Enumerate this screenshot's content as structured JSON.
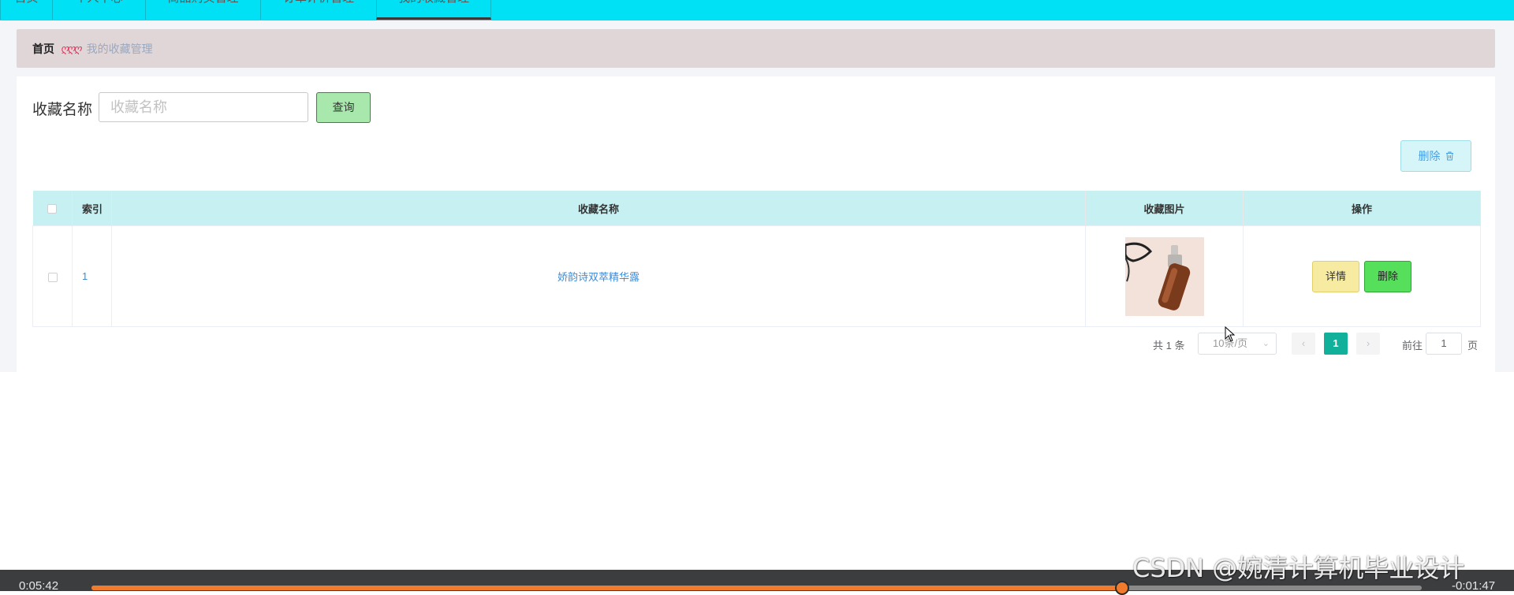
{
  "nav": {
    "tabs": [
      {
        "label": "首页",
        "active": false
      },
      {
        "label": "个人中心",
        "active": false
      },
      {
        "label": "商品购买管理",
        "active": false
      },
      {
        "label": "订单评价管理",
        "active": false
      },
      {
        "label": "我的收藏管理",
        "active": true
      }
    ]
  },
  "breadcrumb": {
    "home": "首页",
    "separator": "ღღღ",
    "current": "我的收藏管理"
  },
  "search": {
    "label": "收藏名称",
    "placeholder": "收藏名称",
    "value": "",
    "button": "查询"
  },
  "toolbar": {
    "delete_label": "删除"
  },
  "table": {
    "columns": [
      "索引",
      "收藏名称",
      "收藏图片",
      "操作"
    ],
    "rows": [
      {
        "index": "1",
        "name": "娇韵诗双萃精华露",
        "image": "serum-bottle",
        "actions": {
          "detail": "详情",
          "delete": "删除"
        }
      }
    ]
  },
  "pagination": {
    "total_text": "共 1 条",
    "page_size": "10条/页",
    "current_page": "1",
    "goto_label": "前往",
    "goto_value": "1",
    "goto_unit": "页"
  },
  "player": {
    "elapsed": "0:05:42",
    "remaining": "-0:01:47",
    "progress": 0.775
  },
  "watermark": "CSDN @婉清计算机毕业设计",
  "colors": {
    "nav_bg": "#00e1f5",
    "table_header_bg": "#c6f0f1",
    "page_active": "#10b09b",
    "progress": "#f07b2c"
  }
}
